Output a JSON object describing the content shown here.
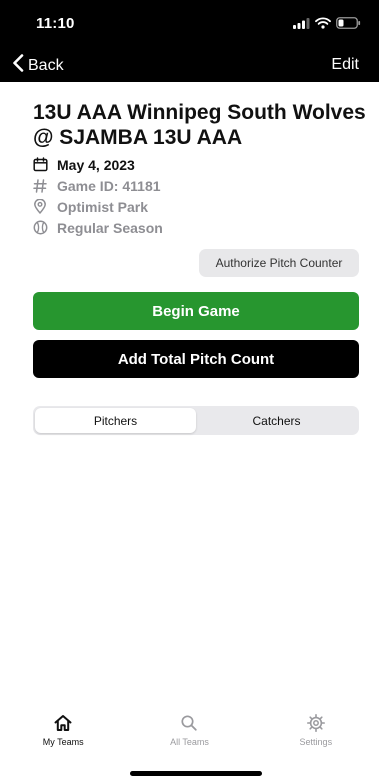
{
  "status_bar": {
    "time": "11:10"
  },
  "nav": {
    "back_label": "Back",
    "edit_label": "Edit"
  },
  "game": {
    "title": "13U AAA Winnipeg South Wolves @ SJAMBA 13U AAA",
    "date": "May 4, 2023",
    "game_id": "Game ID: 41181",
    "location": "Optimist Park",
    "season": "Regular Season"
  },
  "actions": {
    "authorize_label": "Authorize Pitch Counter",
    "begin_label": "Begin Game",
    "total_label": "Add Total Pitch Count"
  },
  "segment": {
    "items": [
      {
        "label": "Pitchers",
        "selected": true
      },
      {
        "label": "Catchers",
        "selected": false
      }
    ]
  },
  "tabbar": {
    "items": [
      {
        "label": "My Teams",
        "icon": "house-icon",
        "active": true
      },
      {
        "label": "All Teams",
        "icon": "search-icon",
        "active": false
      },
      {
        "label": "Settings",
        "icon": "gear-icon",
        "active": false
      }
    ]
  },
  "colors": {
    "accent_green": "#27962f",
    "nav_bg": "#000000",
    "muted": "#8e8e93"
  }
}
